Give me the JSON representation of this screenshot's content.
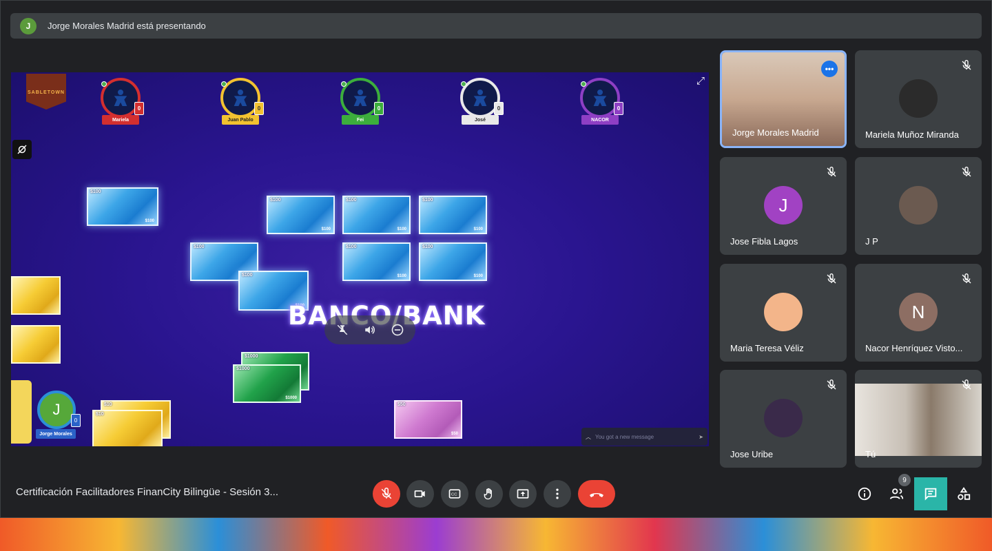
{
  "banner": {
    "avatar_letter": "J",
    "text": "Jorge Morales Madrid está presentando"
  },
  "game": {
    "logo_text": "SABLETOWN",
    "players": [
      {
        "name": "Mariela",
        "count": "0",
        "color": "#d32f2f"
      },
      {
        "name": "Juan Pablo",
        "count": "0",
        "color": "#f2c230"
      },
      {
        "name": "Fei",
        "count": "0",
        "color": "#3cae3c"
      },
      {
        "name": "José",
        "count": "0",
        "color": "#e9e9e9"
      },
      {
        "name": "NACOR",
        "count": "0",
        "color": "#8e3fc4"
      }
    ],
    "bills": [
      "$100",
      "$1000",
      "$10",
      "$50"
    ],
    "bank_label": "BANCO/BANK",
    "message_placeholder": "You got a new message",
    "me": {
      "letter": "J",
      "name": "Jorge Morales",
      "count": "0"
    }
  },
  "participants": [
    {
      "name": "Jorge Morales Madrid",
      "type": "video",
      "active": true
    },
    {
      "name": "Mariela Muñoz Miranda",
      "type": "photo"
    },
    {
      "name": "Jose Fibla Lagos",
      "type": "letter",
      "letter": "J",
      "color": "#a142c3"
    },
    {
      "name": "J P",
      "type": "photo"
    },
    {
      "name": "Maria Teresa Véliz",
      "type": "photo"
    },
    {
      "name": "Nacor Henríquez Visto...",
      "type": "letter",
      "letter": "N",
      "color": "#8d6e63"
    },
    {
      "name": "Jose Uribe",
      "type": "photo"
    },
    {
      "name": "Tú",
      "type": "video"
    }
  ],
  "footer": {
    "meeting_title": "Certificación Facilitadores FinanCity Bilingüe - Sesión 3...",
    "people_count": "9",
    "controls": [
      "mic-off-icon",
      "camera-icon",
      "captions-icon",
      "raise-hand-icon",
      "present-icon",
      "more-options-icon",
      "end-call-icon"
    ],
    "right_controls": [
      "info-icon",
      "people-icon",
      "chat-icon",
      "activities-icon"
    ]
  }
}
